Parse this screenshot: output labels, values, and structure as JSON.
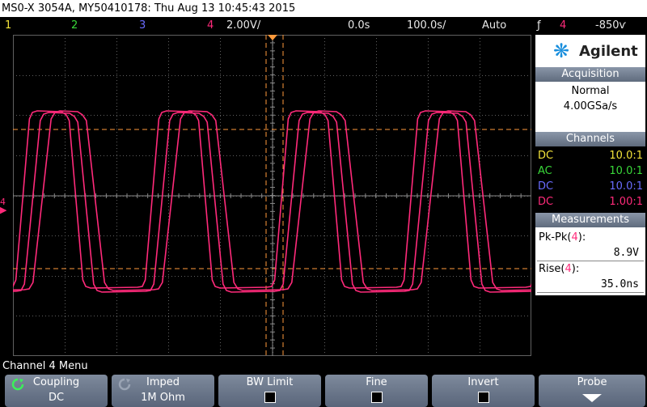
{
  "title": "MS0-X 3054A, MY50410178: Thu Aug 13 10:45:43 2015",
  "status": {
    "ch1": "1",
    "ch2": "2",
    "ch3": "3",
    "ch4": "4",
    "scale": "2.00V/",
    "time_offset": "0.0s",
    "timebase": "100.0ѕ/",
    "trigger_mode": "Auto",
    "trigger_source": "4",
    "trigger_level": "-850ѵ"
  },
  "brand": "Agilent",
  "acquisition": {
    "header": "Acquisition",
    "mode": "Normal",
    "rate": "4.00GSa/s"
  },
  "channels": {
    "header": "Channels",
    "rows": [
      {
        "coupling": "DC",
        "probe": "10.0:1",
        "color": "#f4e43a"
      },
      {
        "coupling": "AC",
        "probe": "10.0:1",
        "color": "#39d839"
      },
      {
        "coupling": "DC",
        "probe": "10.0:1",
        "color": "#6a6cff"
      },
      {
        "coupling": "DC",
        "probe": "1.00:1",
        "color": "#ff2a7a"
      }
    ]
  },
  "measurements": {
    "header": "Measurements",
    "items": [
      {
        "label_prefix": "Pk-Pk(",
        "label_ch": "4",
        "label_suffix": "):",
        "value": "8.9V"
      },
      {
        "label_prefix": "Rise(",
        "label_ch": "4",
        "label_suffix": "):",
        "value": "35.0ns"
      }
    ]
  },
  "menu_title": "Channel 4 Menu",
  "softkeys": [
    {
      "label": "Coupling",
      "value": "DC",
      "icon": "rotate-icon"
    },
    {
      "label": "Imped",
      "value": "1M Ohm",
      "icon": "rotate-icon"
    },
    {
      "label": "BW Limit",
      "value": "",
      "icon": "checkbox"
    },
    {
      "label": "Fine",
      "value": "",
      "icon": "checkbox"
    },
    {
      "label": "Invert",
      "value": "",
      "icon": "checkbox"
    },
    {
      "label": "Probe",
      "value": "",
      "icon": "down-arrow-icon"
    }
  ],
  "colors": {
    "ch4": "#ff2a7a",
    "cursor": "#ff9a3c",
    "grid": "#606060"
  },
  "marker_label": "4"
}
